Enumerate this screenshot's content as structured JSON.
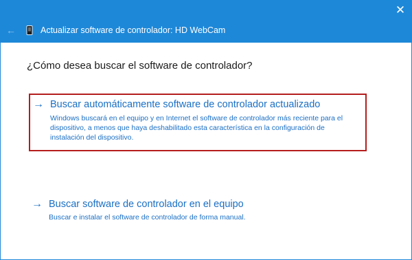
{
  "window": {
    "title": "Actualizar software de controlador: HD WebCam",
    "close_glyph": "✕",
    "back_glyph": "←",
    "accent_color": "#1e88d8",
    "icons": [
      "back-arrow-icon",
      "device-icon",
      "close-icon"
    ]
  },
  "main": {
    "question": "¿Cómo desea buscar el software de controlador?",
    "options": [
      {
        "arrow": "→",
        "title": "Buscar automáticamente software de controlador actualizado",
        "description": "Windows buscará en el equipo y en Internet el software de controlador más reciente para el dispositivo, a menos que haya deshabilitado esta característica en la configuración de instalación del dispositivo.",
        "highlighted": true,
        "highlight_color": "#b51c1c"
      },
      {
        "arrow": "→",
        "title": "Buscar software de controlador en el equipo",
        "description": "Buscar e instalar el software de controlador de forma manual.",
        "highlighted": false
      }
    ],
    "link_color": "#1a6fc4"
  }
}
